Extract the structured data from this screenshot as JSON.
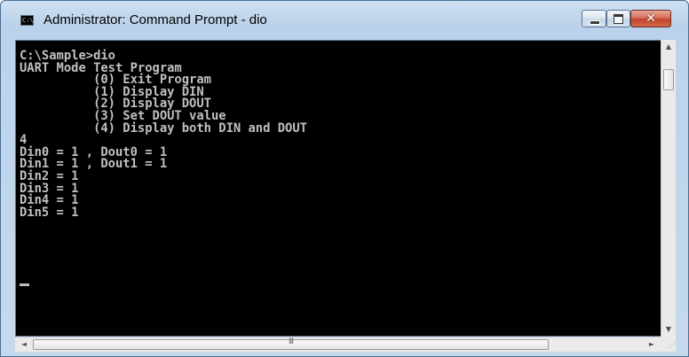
{
  "window": {
    "title": "Administrator: Command Prompt - dio",
    "icon": "console-icon",
    "icon_text": "C:\\",
    "controls": [
      "minimize-icon",
      "maximize-icon",
      "close-icon"
    ],
    "close_glyph": "✕"
  },
  "console": {
    "lines": [
      "C:\\Sample>dio",
      "UART Mode Test Program",
      "          (0) Exit Program",
      "          (1) Display DIN",
      "          (2) Display DOUT",
      "          (3) Set DOUT value",
      "          (4) Display both DIN and DOUT",
      "4",
      "Din0 = 1 , Dout0 = 1",
      "Din1 = 1 , Dout1 = 1",
      "Din2 = 1",
      "Din3 = 1",
      "Din4 = 1",
      "Din5 = 1"
    ]
  },
  "scrollbars": {
    "up_arrow": "▲",
    "down_arrow": "▼",
    "left_arrow": "◄",
    "right_arrow": "►",
    "h_grip": "III"
  },
  "colors": {
    "console_bg": "#000000",
    "console_fg": "#c0c0c0",
    "close_button": "#c2432a"
  }
}
